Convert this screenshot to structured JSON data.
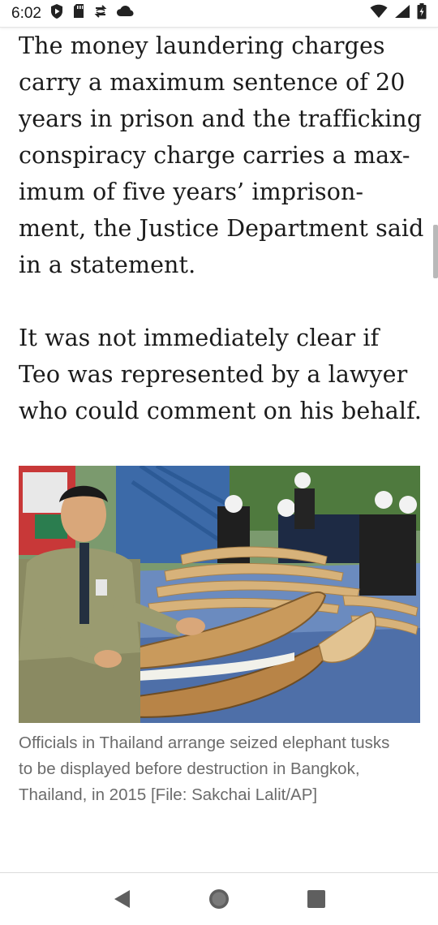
{
  "status_bar": {
    "time": "6:02",
    "left_icons": [
      "shield-play-icon",
      "sd-card-icon",
      "sync-icon",
      "cloud-icon"
    ],
    "right_icons": [
      "wifi-icon",
      "signal-icon",
      "battery-icon"
    ]
  },
  "article": {
    "paragraph_1": "The money laundering charges carry a maximum sentence of 20 years in prison and the trafficking conspiracy charge carries a max-imum of five years’ imprison-ment, the Justice Department said in a statement.",
    "paragraph_2": "It was not immediately clear if Teo was represented by a lawyer who could comment on his behalf.",
    "image_caption": "Officials in Thailand arrange seized elephant tusks to be displayed before destruction in Bangkok, Thailand, in 2015 [File: Sakchai Lalit/AP]"
  },
  "nav_bar": {
    "buttons": [
      "back-icon",
      "home-icon",
      "recents-icon"
    ]
  },
  "colors": {
    "text": "#1b1b1b",
    "caption": "#6b6b6b",
    "nav_icon": "#5f5f5f"
  }
}
